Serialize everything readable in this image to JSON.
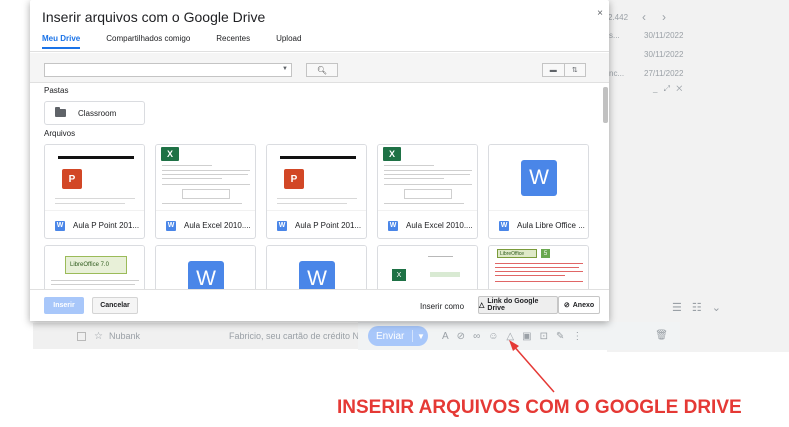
{
  "background": {
    "count": "2.442",
    "nav_prev": "‹",
    "nav_next": "›",
    "dates": [
      "30/11/2022",
      "30/11/2022",
      "30/11/2022",
      "27/11/2022"
    ],
    "truncated": [
      "s...",
      "s...",
      "nc..."
    ],
    "window_controls": "_ ⤢ ✕",
    "email_row": {
      "sender": "Nubank",
      "subject": "Fabricio, seu cartão de crédito Nubank fo"
    },
    "compose": {
      "send_label": "Enviar"
    }
  },
  "dialog": {
    "title": "Inserir arquivos com o Google Drive",
    "close": "×",
    "tabs": [
      {
        "label": "Meu Drive",
        "active": true
      },
      {
        "label": "Compartilhados comigo",
        "active": false
      },
      {
        "label": "Recentes",
        "active": false
      },
      {
        "label": "Upload",
        "active": false
      }
    ],
    "search": {
      "value": "",
      "placeholder": ""
    },
    "folders_label": "Pastas",
    "folders": [
      {
        "name": "Classroom"
      }
    ],
    "files_label": "Arquivos",
    "files": [
      {
        "name": "Aula P Point 201...",
        "kind": "ppt"
      },
      {
        "name": "Aula Excel 2010....",
        "kind": "excel"
      },
      {
        "name": "Aula P Point 201...",
        "kind": "ppt"
      },
      {
        "name": "Aula Excel 2010....",
        "kind": "excel"
      },
      {
        "name": "Aula Libre Office ...",
        "kind": "word"
      },
      {
        "name": "",
        "kind": "libreoffice"
      },
      {
        "name": "",
        "kind": "word"
      },
      {
        "name": "",
        "kind": "word"
      },
      {
        "name": "",
        "kind": "excel-small"
      },
      {
        "name": "",
        "kind": "libreoffice-5"
      }
    ],
    "thumb_text": {
      "word_letter": "W",
      "ppt_letter": "P",
      "excel_letter": "X",
      "lo_banner": "LibreOffice 7.0",
      "lo5_banner": "LibreOffice",
      "lo5_number": "5"
    },
    "footer": {
      "insert_label": "Inserir",
      "cancel_label": "Cancelar",
      "insert_as_label": "Inserir como",
      "drive_link_label": "Link do Google Drive",
      "attachment_label": "Anexo"
    }
  },
  "annotation": {
    "text": "INSERIR ARQUIVOS COM O GOOGLE DRIVE",
    "color": "#e53935"
  },
  "colors": {
    "accent": "#1a73e8",
    "button_disabled": "#a8c7fa",
    "word": "#4a86e8",
    "excel": "#1e7145",
    "ppt": "#d24726"
  }
}
